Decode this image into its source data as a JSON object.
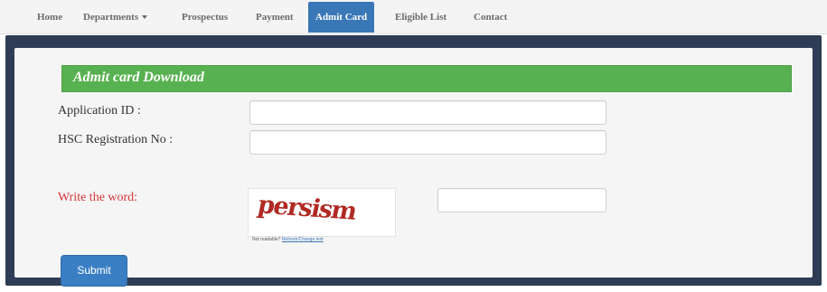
{
  "nav": {
    "items": [
      {
        "label": "Home"
      },
      {
        "label": "Departments"
      },
      {
        "label": "Prospectus"
      },
      {
        "label": "Payment"
      },
      {
        "label": "Admit Card"
      },
      {
        "label": "Eligible List"
      },
      {
        "label": "Contact"
      }
    ],
    "active": "Admit Card"
  },
  "panel": {
    "title": "Admit card Download"
  },
  "form": {
    "application_id_label": "Application ID :",
    "application_id_value": "",
    "hsc_registration_label": "HSC Registration No :",
    "hsc_registration_value": "",
    "captcha_label": "Write the word:",
    "captcha_word": "persism",
    "captcha_answer_value": "",
    "captcha_help_prefix": "Not readable?",
    "captcha_refresh_link": "Refresh/Change text",
    "submit_label": "Submit"
  },
  "colors": {
    "nav_active": "#3a77b7",
    "panel_heading": "#58b150",
    "frame": "#2e3d55",
    "submit": "#3a7fc4",
    "captcha_text": "#b02a23",
    "captcha_label": "#d9363a"
  }
}
